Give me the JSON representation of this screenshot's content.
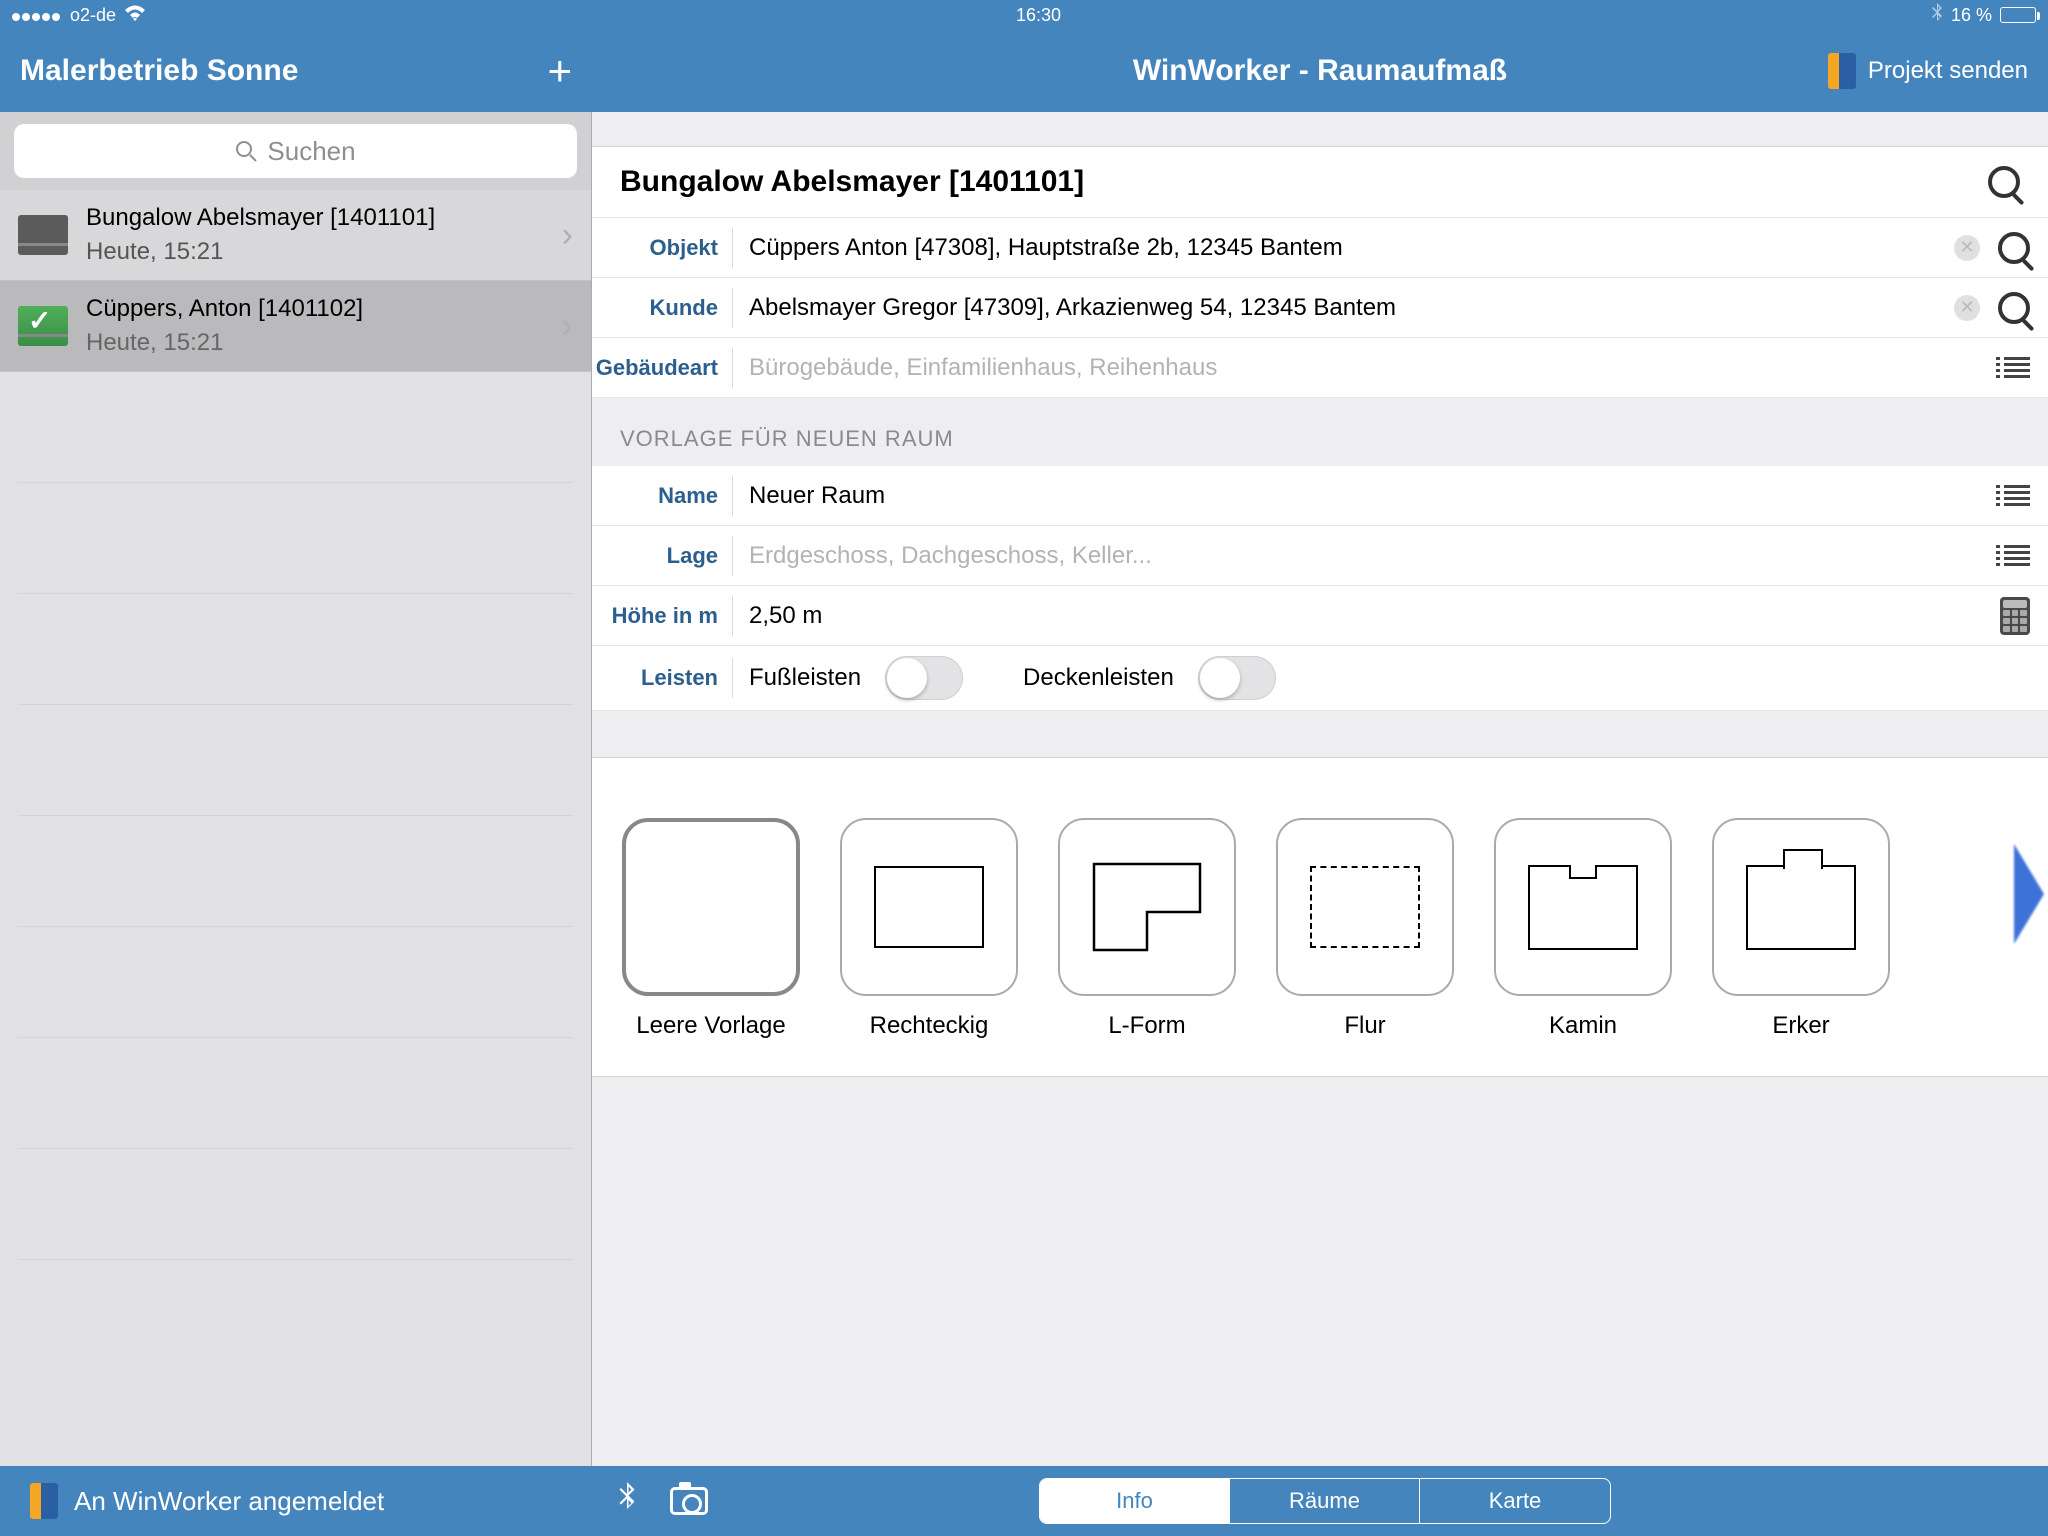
{
  "statusbar": {
    "carrier": "o2-de",
    "time": "16:30",
    "battery": "16 %"
  },
  "nav": {
    "company": "Malerbetrieb Sonne",
    "title": "WinWorker - Raumaufmaß",
    "send": "Projekt senden"
  },
  "sidebar": {
    "search_placeholder": "Suchen",
    "items": [
      {
        "title": "Bungalow Abelsmayer [1401101]",
        "subtitle": "Heute, 15:21"
      },
      {
        "title": "Cüppers, Anton [1401102]",
        "subtitle": "Heute, 15:21"
      }
    ]
  },
  "detail": {
    "project_title": "Bungalow Abelsmayer [1401101]",
    "labels": {
      "objekt": "Objekt",
      "kunde": "Kunde",
      "gebaeudeart": "Gebäudeart",
      "name": "Name",
      "lage": "Lage",
      "hoehe": "Höhe in m",
      "leisten": "Leisten"
    },
    "values": {
      "objekt": "Cüppers Anton [47308], Hauptstraße 2b, 12345 Bantem",
      "kunde": "Abelsmayer Gregor [47309], Arkazienweg 54, 12345 Bantem",
      "gebaeudeart_placeholder": "Bürogebäude, Einfamilienhaus, Reihenhaus",
      "name": "Neuer Raum",
      "lage_placeholder": "Erdgeschoss, Dachgeschoss, Keller...",
      "hoehe": "2,50 m",
      "fussleisten": "Fußleisten",
      "deckenleisten": "Deckenleisten"
    },
    "section_header": "VORLAGE FÜR NEUEN RAUM"
  },
  "templates": [
    "Leere Vorlage",
    "Rechteckig",
    "L-Form",
    "Flur",
    "Kamin",
    "Erker"
  ],
  "footer": {
    "status": "An WinWorker angemeldet",
    "tabs": [
      "Info",
      "Räume",
      "Karte"
    ]
  }
}
